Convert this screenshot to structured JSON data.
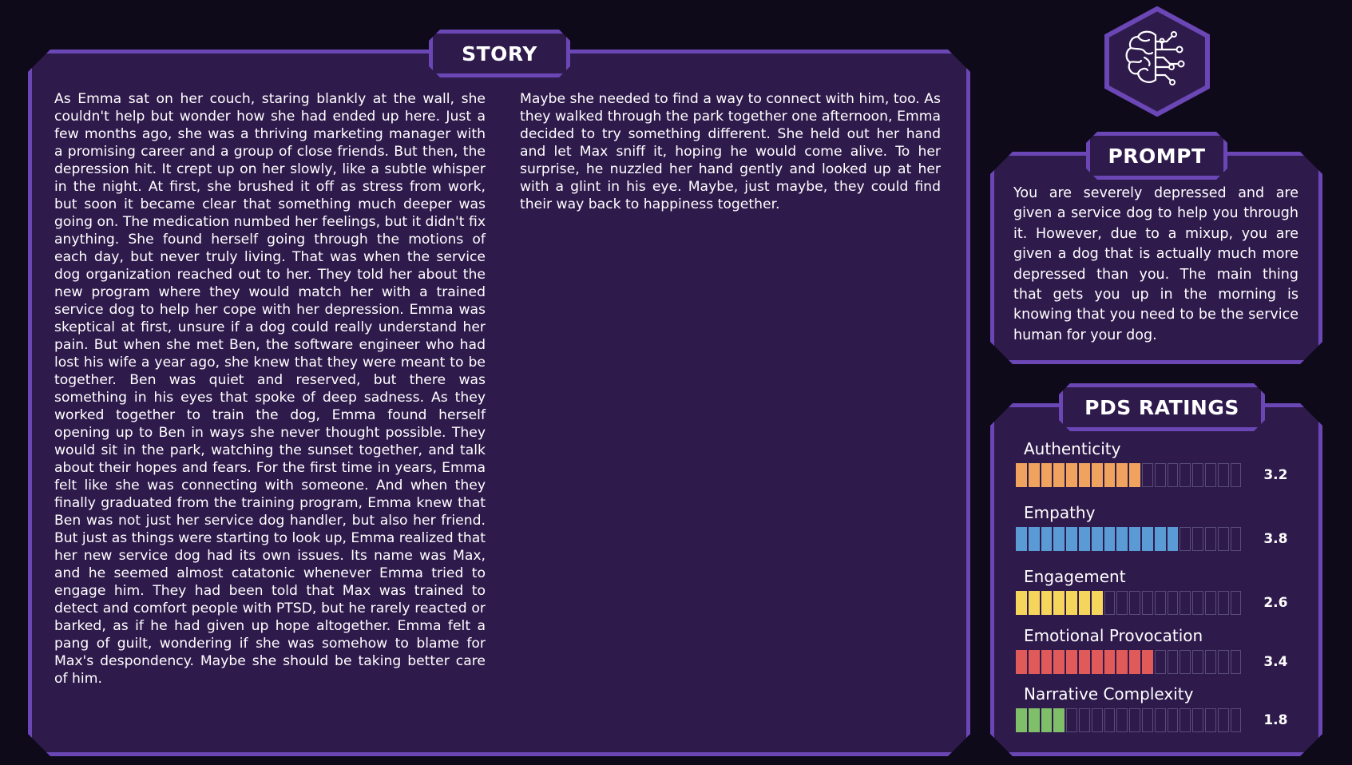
{
  "story": {
    "title": "STORY",
    "column_left": "As Emma sat on her couch, staring blankly at the wall, she couldn't help but wonder how she had ended up here. Just a few months ago, she was a thriving marketing manager with a promising career and a group of close friends. But then, the depression hit. It crept up on her slowly, like a subtle whisper in the night. At first, she brushed it off as stress from work, but soon it became clear that something much deeper was going on. The medication numbed her feelings, but it didn't fix anything. She found herself going through the motions of each day, but never truly living. That was when the service dog organization reached out to her. They told her about the new program where they would match her with a trained service dog to help her cope with her depression. Emma was skeptical at first, unsure if a dog could really understand her pain. But when she met Ben, the software engineer who had lost his wife a year ago, she knew that they were meant to be together. Ben was quiet and reserved, but there was something in his eyes that spoke of deep sadness. As they worked together to train the dog, Emma found herself opening up to Ben in ways she never thought possible. They would sit in the park, watching the sunset together, and talk about their hopes and fears. For the first time in years, Emma felt like she was connecting with someone. And when they finally graduated from the training program, Emma knew that Ben was not just her service dog handler, but also her friend. But just as things were starting to look up, Emma realized that her new service dog had its own issues. Its name was Max, and he seemed almost catatonic whenever Emma tried to engage him. They had been told that Max was trained to detect and comfort people with PTSD, but he rarely reacted or barked, as if he had given up hope altogether. Emma felt a pang of guilt, wondering if she was somehow to blame for Max's despondency. Maybe she should be taking better care of him.",
    "column_right": "Maybe she needed to find a way to connect with him, too. As they walked through the park together one afternoon, Emma decided to try something different. She held out her hand and let Max sniff it, hoping he would come alive. To her surprise, he nuzzled her hand gently and looked up at her with a glint in his eye. Maybe, just maybe, they could find their way back to happiness together."
  },
  "logo": {
    "icon": "brain-circuit-icon"
  },
  "prompt": {
    "title": "PROMPT",
    "text": "You are severely depressed and are given a service dog to help you through it. However, due to a mixup, you are given a dog that is actually much more depressed than you. The main thing that gets you up in the morning is knowing that you need to be the service human for your dog."
  },
  "ratings": {
    "title": "PDS RATINGS",
    "segments_total": 18,
    "items": [
      {
        "label": "Authenticity",
        "score": "3.2",
        "filled": 10,
        "color": "#f0a35e"
      },
      {
        "label": "Empathy",
        "score": "3.8",
        "filled": 13,
        "color": "#5b9bd5"
      },
      {
        "label": "Engagement",
        "score": "2.6",
        "filled": 7,
        "color": "#f6d55c"
      },
      {
        "label": "Emotional Provocation",
        "score": "3.4",
        "filled": 11,
        "color": "#e05a5a"
      },
      {
        "label": "Narrative Complexity",
        "score": "1.8",
        "filled": 4,
        "color": "#7fbf6a"
      }
    ]
  },
  "colors": {
    "background": "#0f0a1a",
    "panel": "#2f1a4c",
    "border": "#6a47b5",
    "empty_segment_border": "#5a4c78"
  }
}
